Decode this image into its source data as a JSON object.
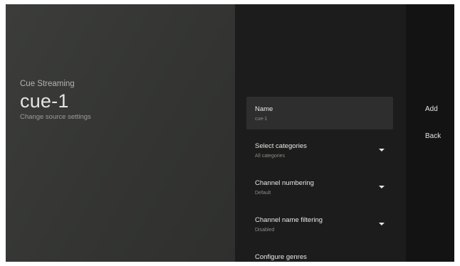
{
  "guidance": {
    "app_name": "Cue Streaming",
    "title": "cue-1",
    "subtitle": "Change source settings"
  },
  "settings": [
    {
      "label": "Name",
      "value": "cue-1",
      "dropdown": false,
      "focused": true
    },
    {
      "label": "Select categories",
      "value": "All categories",
      "dropdown": true,
      "focused": false
    },
    {
      "label": "Channel numbering",
      "value": "Default",
      "dropdown": true,
      "focused": false
    },
    {
      "label": "Channel name filtering",
      "value": "Disabled",
      "dropdown": true,
      "focused": false
    },
    {
      "label": "Configure genres",
      "value": "",
      "dropdown": false,
      "focused": false
    }
  ],
  "actions": {
    "add": "Add",
    "back": "Back"
  },
  "icons": {
    "dropdown": "caret-down-icon"
  }
}
